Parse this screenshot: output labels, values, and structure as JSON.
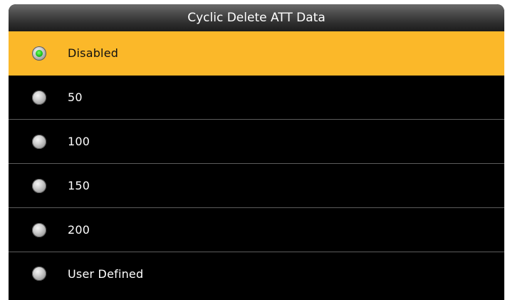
{
  "title": "Cyclic Delete ATT Data",
  "options": [
    {
      "label": "Disabled",
      "selected": true
    },
    {
      "label": "50",
      "selected": false
    },
    {
      "label": "100",
      "selected": false
    },
    {
      "label": "150",
      "selected": false
    },
    {
      "label": "200",
      "selected": false
    },
    {
      "label": "User Defined",
      "selected": false
    }
  ],
  "colors": {
    "selected_background": "#fbb829",
    "list_background": "#000000",
    "radio_selected_dot": "#1ec41e"
  }
}
